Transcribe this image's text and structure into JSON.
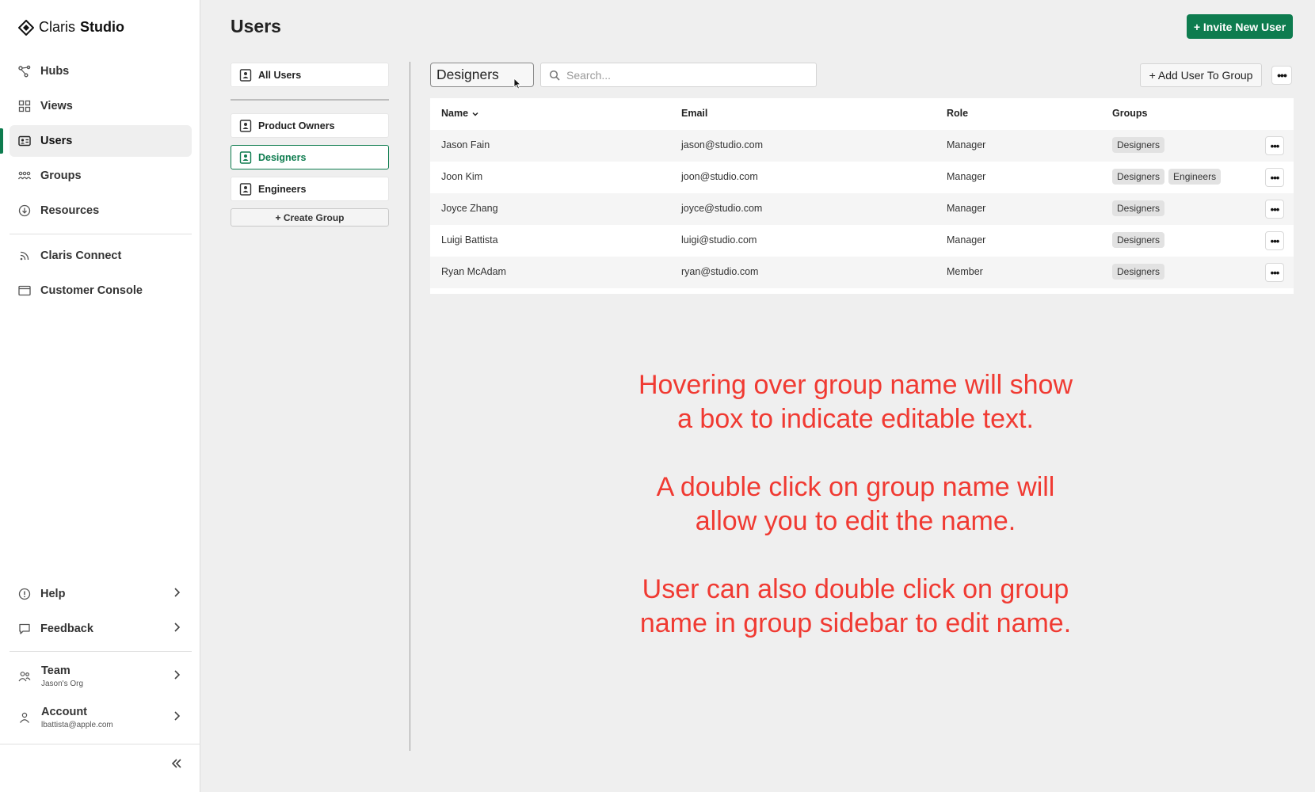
{
  "app": {
    "brand_light": "Claris",
    "brand_bold": "Studio"
  },
  "sidebar": {
    "items": [
      {
        "label": "Hubs",
        "icon": "hubs-icon"
      },
      {
        "label": "Views",
        "icon": "grid-icon"
      },
      {
        "label": "Users",
        "icon": "id-card-icon",
        "active": true
      },
      {
        "label": "Groups",
        "icon": "people-icon"
      },
      {
        "label": "Resources",
        "icon": "download-icon"
      }
    ],
    "secondary": [
      {
        "label": "Claris Connect",
        "icon": "rss-icon"
      },
      {
        "label": "Customer Console",
        "icon": "window-icon"
      }
    ],
    "bottom": {
      "help": "Help",
      "feedback": "Feedback",
      "team_label": "Team",
      "team_sub": "Jason's Org",
      "account_label": "Account",
      "account_sub": "lbattista@apple.com"
    },
    "accent": "#0e7c4f"
  },
  "header": {
    "title": "Users",
    "invite_label": "+ Invite New User"
  },
  "groups": {
    "all": "All Users",
    "items": [
      "Product Owners",
      "Designers",
      "Engineers"
    ],
    "selected": "Designers",
    "create_label": "+ Create Group"
  },
  "toolbar": {
    "group_name": "Designers",
    "search_placeholder": "Search...",
    "add_user_label": "+ Add User To Group",
    "more": "•••"
  },
  "table": {
    "columns": [
      "Name",
      "Email",
      "Role",
      "Groups"
    ],
    "rows": [
      {
        "name": "Jason Fain",
        "email": "jason@studio.com",
        "role": "Manager",
        "groups": [
          "Designers"
        ]
      },
      {
        "name": "Joon Kim",
        "email": "joon@studio.com",
        "role": "Manager",
        "groups": [
          "Designers",
          "Engineers"
        ]
      },
      {
        "name": "Joyce Zhang",
        "email": "joyce@studio.com",
        "role": "Manager",
        "groups": [
          "Designers"
        ]
      },
      {
        "name": "Luigi Battista",
        "email": "luigi@studio.com",
        "role": "Manager",
        "groups": [
          "Designers"
        ]
      },
      {
        "name": "Ryan McAdam",
        "email": "ryan@studio.com",
        "role": "Member",
        "groups": [
          "Designers"
        ]
      }
    ]
  },
  "annotation": {
    "color": "#f03a32",
    "paragraphs": [
      "Hovering over group name will show a box to indicate editable text.",
      "A double click on group name will allow you to edit the name.",
      "User can also double click on group name in group sidebar to edit name."
    ]
  }
}
